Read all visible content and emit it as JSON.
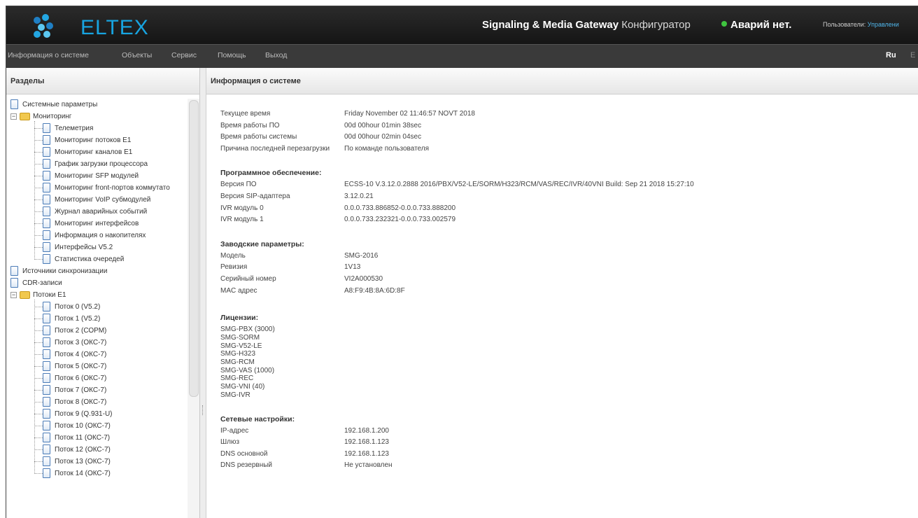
{
  "header": {
    "logo": "ELTEX",
    "title_bold": "Signaling & Media Gateway",
    "title_light": "Конфигуратор",
    "alarm": "Аварий нет.",
    "users_label": "Пользователи:",
    "users_link": "Управлени",
    "alarm_color": "#3fc43f"
  },
  "menu": {
    "items": [
      "Информация о системе",
      "Объекты",
      "Сервис",
      "Помощь",
      "Выход"
    ],
    "lang_ru": "Ru",
    "lang_en": "E"
  },
  "left": {
    "title": "Разделы",
    "tree": [
      {
        "label": "Системные параметры",
        "level": 0,
        "type": "doc"
      },
      {
        "label": "Мониторинг",
        "level": 0,
        "type": "folder"
      },
      {
        "label": "Телеметрия",
        "level": 1,
        "type": "doc"
      },
      {
        "label": "Мониторинг потоков E1",
        "level": 1,
        "type": "doc"
      },
      {
        "label": "Мониторинг каналов E1",
        "level": 1,
        "type": "doc"
      },
      {
        "label": "График загрузки процессора",
        "level": 1,
        "type": "doc"
      },
      {
        "label": "Мониторинг SFP модулей",
        "level": 1,
        "type": "doc"
      },
      {
        "label": "Мониторинг front-портов коммутато",
        "level": 1,
        "type": "doc"
      },
      {
        "label": "Мониторинг VoIP субмодулей",
        "level": 1,
        "type": "doc"
      },
      {
        "label": "Журнал аварийных событий",
        "level": 1,
        "type": "doc"
      },
      {
        "label": "Мониторинг интерфейсов",
        "level": 1,
        "type": "doc"
      },
      {
        "label": "Информация о накопителях",
        "level": 1,
        "type": "doc"
      },
      {
        "label": "Интерфейсы V5.2",
        "level": 1,
        "type": "doc"
      },
      {
        "label": "Статистика очередей",
        "level": 1,
        "type": "doc"
      },
      {
        "label": "Источники синхронизации",
        "level": 0,
        "type": "doc"
      },
      {
        "label": "CDR-записи",
        "level": 0,
        "type": "doc"
      },
      {
        "label": "Потоки E1",
        "level": 0,
        "type": "folder"
      },
      {
        "label": "Поток 0 (V5.2)",
        "level": 1,
        "type": "doc"
      },
      {
        "label": "Поток 1 (V5.2)",
        "level": 1,
        "type": "doc"
      },
      {
        "label": "Поток 2 (СОРМ)",
        "level": 1,
        "type": "doc"
      },
      {
        "label": "Поток 3 (ОКС-7)",
        "level": 1,
        "type": "doc"
      },
      {
        "label": "Поток 4 (ОКС-7)",
        "level": 1,
        "type": "doc"
      },
      {
        "label": "Поток 5 (ОКС-7)",
        "level": 1,
        "type": "doc"
      },
      {
        "label": "Поток 6 (ОКС-7)",
        "level": 1,
        "type": "doc"
      },
      {
        "label": "Поток 7 (ОКС-7)",
        "level": 1,
        "type": "doc"
      },
      {
        "label": "Поток 8 (ОКС-7)",
        "level": 1,
        "type": "doc"
      },
      {
        "label": "Поток 9 (Q.931-U)",
        "level": 1,
        "type": "doc"
      },
      {
        "label": "Поток 10 (ОКС-7)",
        "level": 1,
        "type": "doc"
      },
      {
        "label": "Поток 11 (ОКС-7)",
        "level": 1,
        "type": "doc"
      },
      {
        "label": "Поток 12 (ОКС-7)",
        "level": 1,
        "type": "doc"
      },
      {
        "label": "Поток 13 (ОКС-7)",
        "level": 1,
        "type": "doc"
      },
      {
        "label": "Поток 14 (ОКС-7)",
        "level": 1,
        "type": "doc"
      }
    ]
  },
  "right": {
    "title": "Информация о системе",
    "time_rows": [
      {
        "k": "Текущее время",
        "v": "Friday November 02 11:46:57 NOVT 2018"
      },
      {
        "k": "Время работы ПО",
        "v": "00d 00hour 01min 38sec"
      },
      {
        "k": "Время работы системы",
        "v": "00d 00hour 02min 04sec"
      },
      {
        "k": "Причина последней перезагрузки",
        "v": "По команде пользователя"
      }
    ],
    "software": {
      "title": "Программное обеспечение:",
      "rows": [
        {
          "k": "Версия ПО",
          "v": "ECSS-10 V.3.12.0.2888 2016/PBX/V52-LE/SORM/H323/RCM/VAS/REC/IVR/40VNI Build: Sep 21 2018 15:27:10"
        },
        {
          "k": "Версия SIP-адаптера",
          "v": "3.12.0.21"
        },
        {
          "k": "IVR модуль 0",
          "v": "0.0.0.733.886852-0.0.0.733.888200"
        },
        {
          "k": "IVR модуль 1",
          "v": "0.0.0.733.232321-0.0.0.733.002579"
        }
      ]
    },
    "factory": {
      "title": "Заводские параметры:",
      "rows": [
        {
          "k": "Модель",
          "v": "SMG-2016"
        },
        {
          "k": "Ревизия",
          "v": "1V13"
        },
        {
          "k": "Серийный номер",
          "v": "VI2A000530"
        },
        {
          "k": "MAC адрес",
          "v": "A8:F9:4B:8A:6D:8F"
        }
      ]
    },
    "licenses": {
      "title": "Лицензии:",
      "items": [
        "SMG-PBX (3000)",
        "SMG-SORM",
        "SMG-V52-LE",
        "SMG-H323",
        "SMG-RCM",
        "SMG-VAS (1000)",
        "SMG-REC",
        "SMG-VNI (40)",
        "SMG-IVR"
      ]
    },
    "network": {
      "title": "Сетевые настройки:",
      "rows": [
        {
          "k": "IP-адрес",
          "v": "192.168.1.200"
        },
        {
          "k": "Шлюз",
          "v": "192.168.1.123"
        },
        {
          "k": "DNS основной",
          "v": "192.168.1.123"
        },
        {
          "k": "DNS резервный",
          "v": "Не установлен"
        }
      ]
    }
  }
}
